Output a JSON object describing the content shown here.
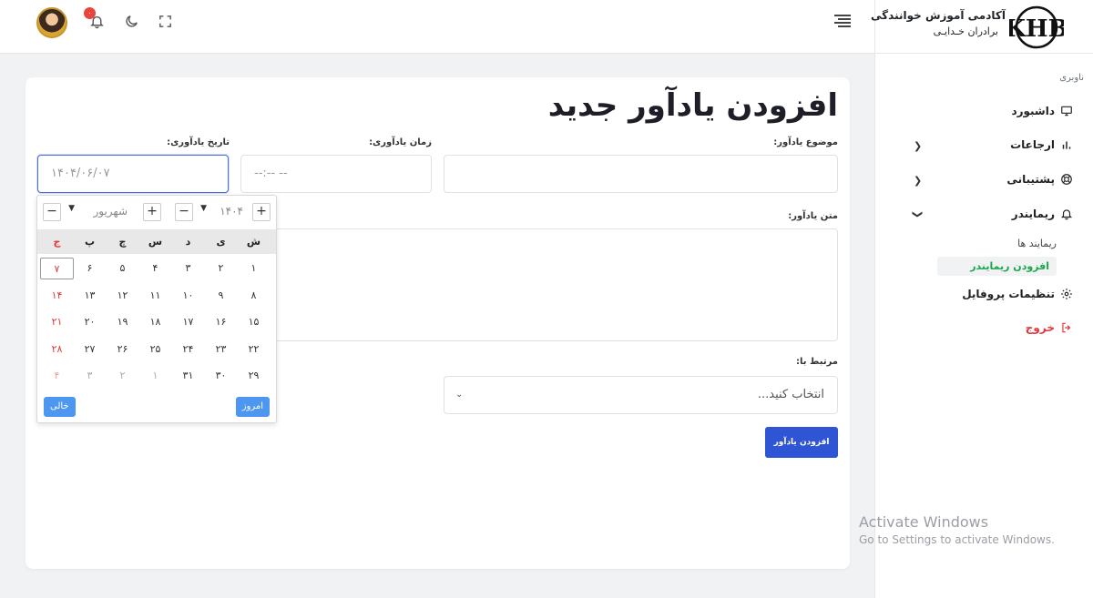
{
  "brand": {
    "title": "آکادمی آموزش خوانندگی",
    "subtitle": "برادران خـدایـی",
    "logo_text": "KHB"
  },
  "header": {
    "notifications_count": "۰"
  },
  "sidebar": {
    "caption": "ناوبری",
    "items": [
      {
        "label": "داشبورد",
        "icon": "monitor-icon"
      },
      {
        "label": "ارجاعات",
        "icon": "chart-icon"
      },
      {
        "label": "پشتیبانی",
        "icon": "lifebuoy-icon"
      },
      {
        "label": "ریمایندر",
        "icon": "bell-icon"
      },
      {
        "label": "تنظیمات پروفایل",
        "icon": "gear-icon"
      },
      {
        "label": "خروج",
        "icon": "logout-icon"
      }
    ],
    "sub_items": [
      {
        "label": "ریمایند ها"
      },
      {
        "label": "افزودن ریمایندر"
      }
    ]
  },
  "form": {
    "title": "افزودن یادآور جدید",
    "subject_label": "موضوع یادآور:",
    "subject_value": "",
    "time_label": "زمان یادآوری:",
    "time_value": "--:-- --",
    "date_label": "تاریخ یادآوری:",
    "date_value": "۱۴۰۴/۰۶/۰۷",
    "text_label": "متن یادآور:",
    "related_label": "مرتبط با:",
    "related_placeholder": "انتخاب کنید...",
    "submit_label": "افزودن یادآور"
  },
  "calendar": {
    "year": "۱۴۰۴",
    "month": "شهریور",
    "weekdays": [
      "ش",
      "ی",
      "د",
      "س",
      "چ",
      "پ",
      "ج"
    ],
    "weeks": [
      [
        "۱",
        "۲",
        "۳",
        "۴",
        "۵",
        "۶",
        "۷"
      ],
      [
        "۸",
        "۹",
        "۱۰",
        "۱۱",
        "۱۲",
        "۱۳",
        "۱۴"
      ],
      [
        "۱۵",
        "۱۶",
        "۱۷",
        "۱۸",
        "۱۹",
        "۲۰",
        "۲۱"
      ],
      [
        "۲۲",
        "۲۳",
        "۲۴",
        "۲۵",
        "۲۶",
        "۲۷",
        "۲۸"
      ],
      [
        "۲۹",
        "۳۰",
        "۳۱",
        "۱",
        "۲",
        "۳",
        "۴"
      ]
    ],
    "selected_day": "۷",
    "today_label": "امروز",
    "clear_label": "خالی"
  },
  "watermark": {
    "line1": "Activate Windows",
    "line2": "Go to Settings to activate Windows."
  },
  "colors": {
    "primary": "#2f55d4",
    "active_green": "#1aa64a",
    "danger": "#e0363a",
    "calendar_action": "#4d97f0"
  }
}
